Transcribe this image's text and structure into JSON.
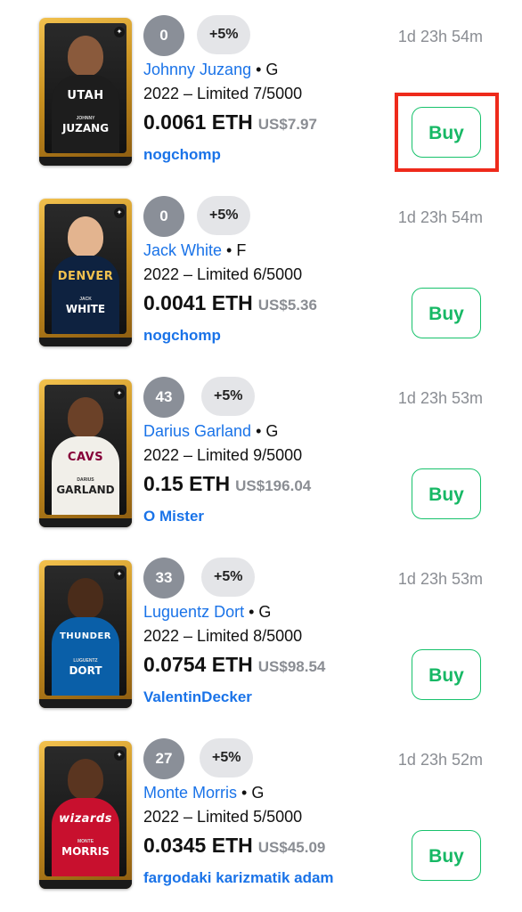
{
  "listings": [
    {
      "count": "0",
      "pct": "+5%",
      "time": "1d 23h 54m",
      "player": "Johnny Juzang",
      "position": "G",
      "edition": "2022 – Limited 7/5000",
      "eth": "0.0061 ETH",
      "usd": "US$7.97",
      "seller": "nogchomp",
      "buy_label": "Buy",
      "card": {
        "team": "UTAH",
        "first": "JOHNNY",
        "last": "JUZANG",
        "jersey_color": "#1d1d1d",
        "head_color": "#8a5a3c"
      },
      "highlighted": true
    },
    {
      "count": "0",
      "pct": "+5%",
      "time": "1d 23h 54m",
      "player": "Jack White",
      "position": "F",
      "edition": "2022 – Limited 6/5000",
      "eth": "0.0041 ETH",
      "usd": "US$5.36",
      "seller": "nogchomp",
      "buy_label": "Buy",
      "card": {
        "team": "DENVER",
        "first": "JACK",
        "last": "WHITE",
        "jersey_color": "#0e2240",
        "head_color": "#e3b48f"
      },
      "highlighted": false
    },
    {
      "count": "43",
      "pct": "+5%",
      "time": "1d 23h 53m",
      "player": "Darius Garland",
      "position": "G",
      "edition": "2022 – Limited 9/5000",
      "eth": "0.15 ETH",
      "usd": "US$196.04",
      "seller": "O Mister",
      "buy_label": "Buy",
      "card": {
        "team": "CAVS",
        "first": "DARIUS",
        "last": "GARLAND",
        "jersey_color": "#f1efe9",
        "head_color": "#6b4128"
      },
      "highlighted": false
    },
    {
      "count": "33",
      "pct": "+5%",
      "time": "1d 23h 53m",
      "player": "Luguentz Dort",
      "position": "G",
      "edition": "2022 – Limited 8/5000",
      "eth": "0.0754 ETH",
      "usd": "US$98.54",
      "seller": "ValentinDecker",
      "buy_label": "Buy",
      "card": {
        "team": "THUNDER",
        "first": "LUGUENTZ",
        "last": "DORT",
        "jersey_color": "#0a5fa8",
        "head_color": "#4a2c1a"
      },
      "highlighted": false
    },
    {
      "count": "27",
      "pct": "+5%",
      "time": "1d 23h 52m",
      "player": "Monte Morris",
      "position": "G",
      "edition": "2022 – Limited 5/5000",
      "eth": "0.0345 ETH",
      "usd": "US$45.09",
      "seller": "fargodaki karizmatik adam",
      "buy_label": "Buy",
      "card": {
        "team": "wizards",
        "first": "MONTE",
        "last": "MORRIS",
        "jersey_color": "#c8102e",
        "head_color": "#5a3520"
      },
      "highlighted": false
    }
  ]
}
